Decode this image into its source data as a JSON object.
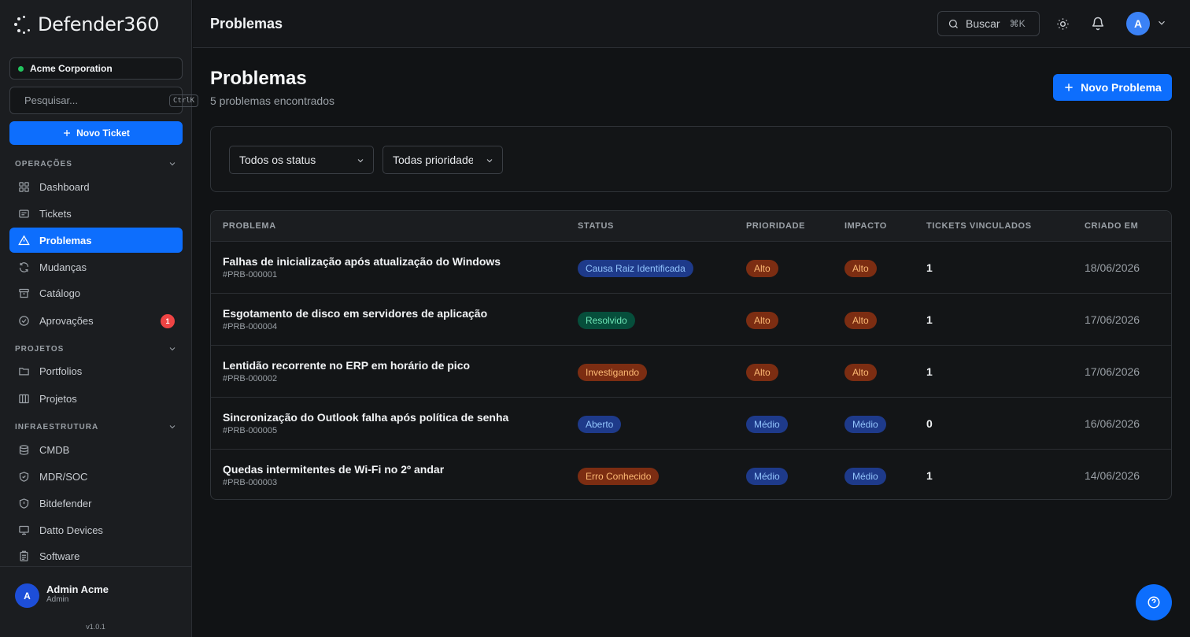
{
  "app": {
    "logo": "Defender360"
  },
  "sidebar": {
    "org": "Acme Corporation",
    "search": {
      "placeholder": "Pesquisar...",
      "shortcut": "CtrlK"
    },
    "new_ticket": "Novo Ticket",
    "sections": {
      "operacoes": "OPERAÇÕES",
      "projetos": "PROJETOS",
      "infra": "INFRAESTRUTURA"
    },
    "items": {
      "dashboard": "Dashboard",
      "tickets": "Tickets",
      "problemas": "Problemas",
      "mudancas": "Mudanças",
      "catalogo": "Catálogo",
      "aprovacoes": "Aprovações",
      "aprovacoes_badge": "1",
      "portfolios": "Portfolios",
      "projetos": "Projetos",
      "cmdb": "CMDB",
      "mdr": "MDR/SOC",
      "bitdefender": "Bitdefender",
      "datto": "Datto Devices",
      "software": "Software"
    },
    "user": {
      "initial": "A",
      "name": "Admin Acme",
      "role": "Admin"
    },
    "version": "v1.0.1"
  },
  "header": {
    "title": "Problemas",
    "search_label": "Buscar",
    "search_shortcut": "⌘K",
    "avatar_initial": "A"
  },
  "main": {
    "title": "Problemas",
    "subtitle": "5 problemas encontrados",
    "new_button": "Novo Problema",
    "filters": {
      "status": "Todos os status",
      "priority": "Todas prioridades"
    },
    "table": {
      "columns": [
        "PROBLEMA",
        "STATUS",
        "PRIORIDADE",
        "IMPACTO",
        "TICKETS VINCULADOS",
        "CRIADO EM"
      ],
      "rows": [
        {
          "title": "Falhas de inicialização após atualização do Windows",
          "id": "#PRB-000001",
          "status": "Causa Raiz Identificada",
          "priority": "Alto",
          "impact": "Alto",
          "linked": "1",
          "created": "18/06/2026"
        },
        {
          "title": "Esgotamento de disco em servidores de aplicação",
          "id": "#PRB-000004",
          "status": "Resolvido",
          "priority": "Alto",
          "impact": "Alto",
          "linked": "1",
          "created": "17/06/2026"
        },
        {
          "title": "Lentidão recorrente no ERP em horário de pico",
          "id": "#PRB-000002",
          "status": "Investigando",
          "priority": "Alto",
          "impact": "Alto",
          "linked": "1",
          "created": "17/06/2026"
        },
        {
          "title": "Sincronização do Outlook falha após política de senha",
          "id": "#PRB-000005",
          "status": "Aberto",
          "priority": "Médio",
          "impact": "Médio",
          "linked": "0",
          "created": "16/06/2026"
        },
        {
          "title": "Quedas intermitentes de Wi-Fi no 2º andar",
          "id": "#PRB-000003",
          "status": "Erro Conhecido",
          "priority": "Médio",
          "impact": "Médio",
          "linked": "1",
          "created": "14/06/2026"
        }
      ]
    }
  },
  "colors": {
    "accent": "#0d6efd",
    "online": "#22c55e",
    "badge": "#ef4444"
  }
}
